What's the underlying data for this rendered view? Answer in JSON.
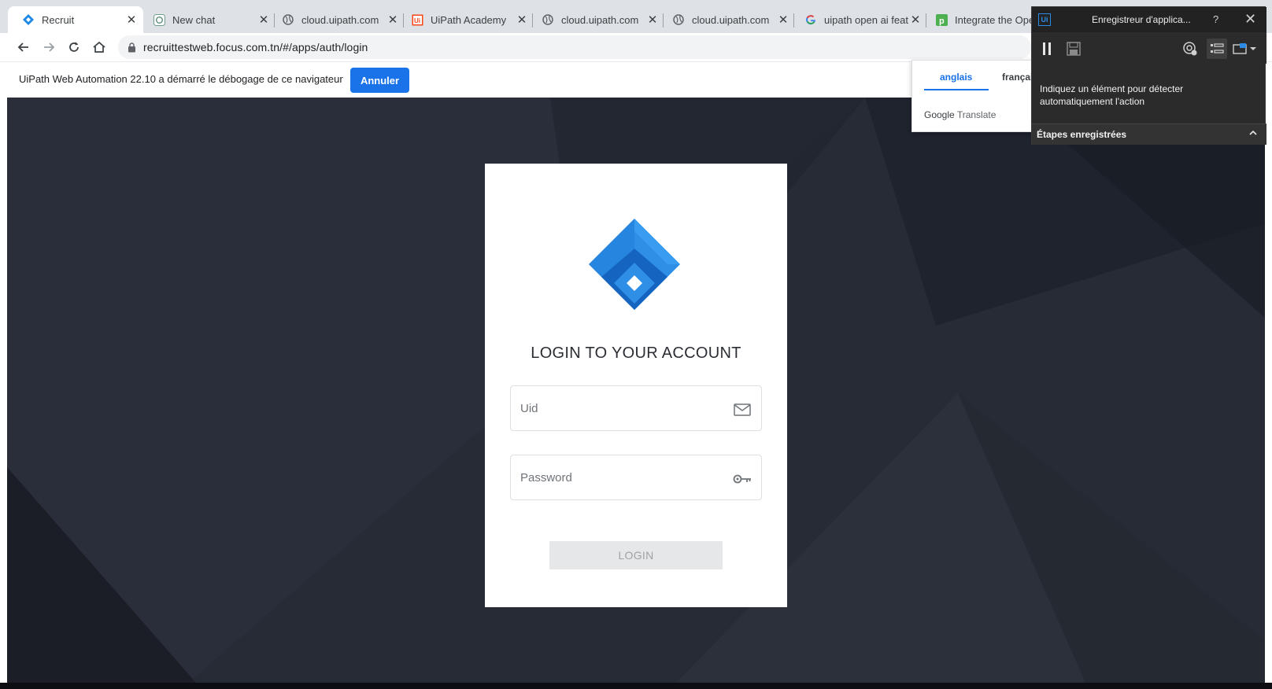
{
  "browser": {
    "tabs": [
      {
        "title": "Recruit",
        "icon": "recruit-logo-icon",
        "active": true
      },
      {
        "title": "New chat",
        "icon": "chatgpt-icon"
      },
      {
        "title": "cloud.uipath.com",
        "icon": "globe-icon"
      },
      {
        "title": "UiPath Academy",
        "icon": "uipath-icon"
      },
      {
        "title": "cloud.uipath.com",
        "icon": "globe-icon"
      },
      {
        "title": "cloud.uipath.com",
        "icon": "globe-icon"
      },
      {
        "title": "uipath open ai feat",
        "icon": "google-icon"
      },
      {
        "title": "Integrate the Oper",
        "icon": "p-app-icon"
      }
    ],
    "url": "recruittestweb.focus.com.tn/#/apps/auth/login"
  },
  "infobar": {
    "message": "UiPath Web Automation 22.10 a démarré le débogage de ce navigateur",
    "cancel_label": "Annuler"
  },
  "translate": {
    "source_lang": "anglais",
    "target_lang": "français",
    "brand_google": "Google",
    "brand_translate": "Translate"
  },
  "recorder": {
    "title": "Enregistreur d'applica...",
    "logo_text": "Ui",
    "help": "?",
    "hint": "Indiquez un élément pour détecter automatiquement l'action",
    "steps_label": "Étapes enregistrées"
  },
  "login": {
    "title": "LOGIN TO YOUR ACCOUNT",
    "uid_placeholder": "Uid",
    "password_placeholder": "Password",
    "button_label": "LOGIN"
  },
  "colors": {
    "brand_blue": "#1a73e8",
    "page_bg": "#262a35",
    "logo_blue": "#2b8ce8"
  }
}
